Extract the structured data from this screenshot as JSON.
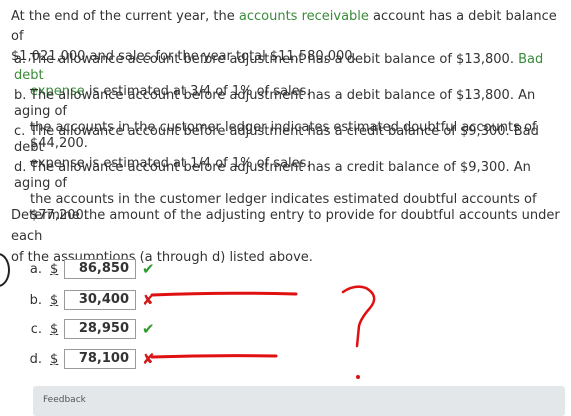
{
  "intro": {
    "text_1": "At the end of the current year, the ",
    "link_ar": "accounts receivable",
    "text_2": " account has a debit balance of",
    "text_3": "$1,021,000 and sales for the year total $11,580,000."
  },
  "options": {
    "a": {
      "letter": "a.",
      "line1_pre": "The allowance account before adjustment has a debit balance of $13,800. ",
      "line1_link": "Bad debt",
      "line2_link": "expense",
      "line2_post": " is estimated at 3/4 of 1% of sales."
    },
    "b": {
      "letter": "b.",
      "line1": "The allowance account before adjustment has a debit balance of $13,800. An aging of",
      "line2": "the accounts in the customer ledger indicates estimated doubtful accounts of $44,200."
    },
    "c": {
      "letter": "c.",
      "line1": "The allowance account before adjustment has a credit balance of $9,300. Bad debt",
      "line2": "expense is estimated at 1/4 of 1% of sales."
    },
    "d": {
      "letter": "d.",
      "line1": "The allowance account before adjustment has a credit balance of $9,300. An aging of",
      "line2": "the accounts in the customer ledger indicates estimated doubtful accounts of $77,200."
    }
  },
  "question": {
    "line1": "Determine the amount of the adjusting entry to provide for doubtful accounts under each",
    "line2": "of the assumptions (a through d) listed above."
  },
  "answers": [
    {
      "letter": "a.",
      "currency": "$",
      "value": "86,850",
      "mark": "✔",
      "status": "correct"
    },
    {
      "letter": "b.",
      "currency": "$",
      "value": "30,400",
      "mark": "✘",
      "status": "incorrect"
    },
    {
      "letter": "c.",
      "currency": "$",
      "value": "28,950",
      "mark": "✔",
      "status": "correct"
    },
    {
      "letter": "d.",
      "currency": "$",
      "value": "78,100",
      "mark": "✘",
      "status": "incorrect"
    }
  ],
  "feedback": {
    "label": "Feedback"
  },
  "colors": {
    "link": "#3a8a3a",
    "correct": "#2e9a2e",
    "incorrect": "#d11a1a"
  }
}
